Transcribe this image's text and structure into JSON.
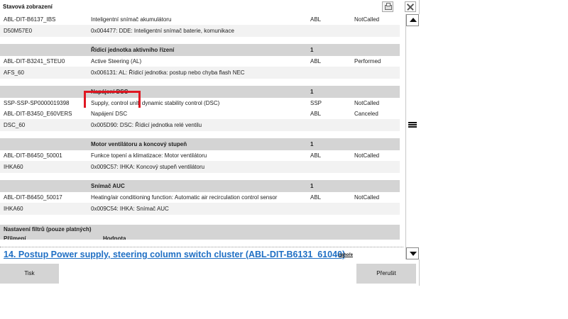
{
  "window": {
    "title": "Stavová zobrazení"
  },
  "rows": [
    {
      "kind": "data",
      "bg": "white",
      "c1": "ABL-DIT-B6137_IBS",
      "c2": "Inteligentní snímač akumulátoru",
      "c3": "ABL",
      "c4": "NotCalled"
    },
    {
      "kind": "data",
      "bg": "light",
      "c1": "D50M57E0",
      "c2": "0x004477: DDE: Inteligentní snímač baterie, komunikace",
      "c3": "",
      "c4": ""
    },
    {
      "kind": "spacer"
    },
    {
      "kind": "header",
      "c1": "",
      "c2": "Řídicí jednotka aktivního řízení",
      "c3": "1",
      "c4": ""
    },
    {
      "kind": "data",
      "bg": "white",
      "c1": "ABL-DIT-B3241_STEU0",
      "c2": "Active Steering (AL)",
      "c3": "ABL",
      "c4": "Performed"
    },
    {
      "kind": "data",
      "bg": "light",
      "c1": "AFS_60",
      "c2": "0x006131: AL: Řídicí jednotka: postup nebo chyba flash NEC",
      "c3": "",
      "c4": ""
    },
    {
      "kind": "spacer"
    },
    {
      "kind": "header",
      "c1": "",
      "c2": "Napájení DSC",
      "c3": "1",
      "c4": ""
    },
    {
      "kind": "data",
      "bg": "white",
      "c1": "SSP-SSP-SP0000019398",
      "c2": "Supply, control unit, dynamic stability control (DSC)",
      "c3": "SSP",
      "c4": "NotCalled"
    },
    {
      "kind": "data",
      "bg": "white",
      "c1": "ABL-DIT-B3450_E60VERS",
      "c2": "Napájení DSC",
      "c3": "ABL",
      "c4": "Canceled"
    },
    {
      "kind": "data",
      "bg": "light",
      "c1": "DSC_60",
      "c2": "0x005D90: DSC: Řídicí jednotka relé ventilu",
      "c3": "",
      "c4": ""
    },
    {
      "kind": "spacer"
    },
    {
      "kind": "header",
      "c1": "",
      "c2": "Motor ventilátoru a koncový stupeň",
      "c3": "1",
      "c4": ""
    },
    {
      "kind": "data",
      "bg": "white",
      "c1": "ABL-DIT-B6450_50001",
      "c2": "Funkce topení a klimatizace: Motor ventilátoru",
      "c3": "ABL",
      "c4": "NotCalled"
    },
    {
      "kind": "data",
      "bg": "light",
      "c1": "IHKA60",
      "c2": "0x009C57: IHKA: Koncový stupeň ventilátoru",
      "c3": "",
      "c4": ""
    },
    {
      "kind": "spacer"
    },
    {
      "kind": "header",
      "c1": "",
      "c2": "Snímač AUC",
      "c3": "1",
      "c4": ""
    },
    {
      "kind": "data",
      "bg": "white",
      "c1": "ABL-DIT-B6450_50017",
      "c2": "Heating/air conditioning function: Automatic air recirculation control sensor",
      "c3": "ABL",
      "c4": "NotCalled"
    },
    {
      "kind": "data",
      "bg": "light",
      "c1": "IHKA60",
      "c2": "0x009C54: IHKA: Snímač AUC",
      "c3": "",
      "c4": ""
    },
    {
      "kind": "bigspacer"
    }
  ],
  "filter": {
    "title": "Nastavení filtrů (pouze platných)",
    "col1": "Příjmení",
    "col2": "Hodnota"
  },
  "section_link": {
    "text": "14. Postup Power supply, steering column switch cluster (ABL-DIT-B6131_61040)",
    "up": "nahoře"
  },
  "footer": {
    "print_label": "Tisk",
    "cancel_label": "Přerušit"
  },
  "colors": {
    "highlight": "#e01722",
    "link": "#1f6fc4",
    "header_bg": "#d4d4d4"
  }
}
